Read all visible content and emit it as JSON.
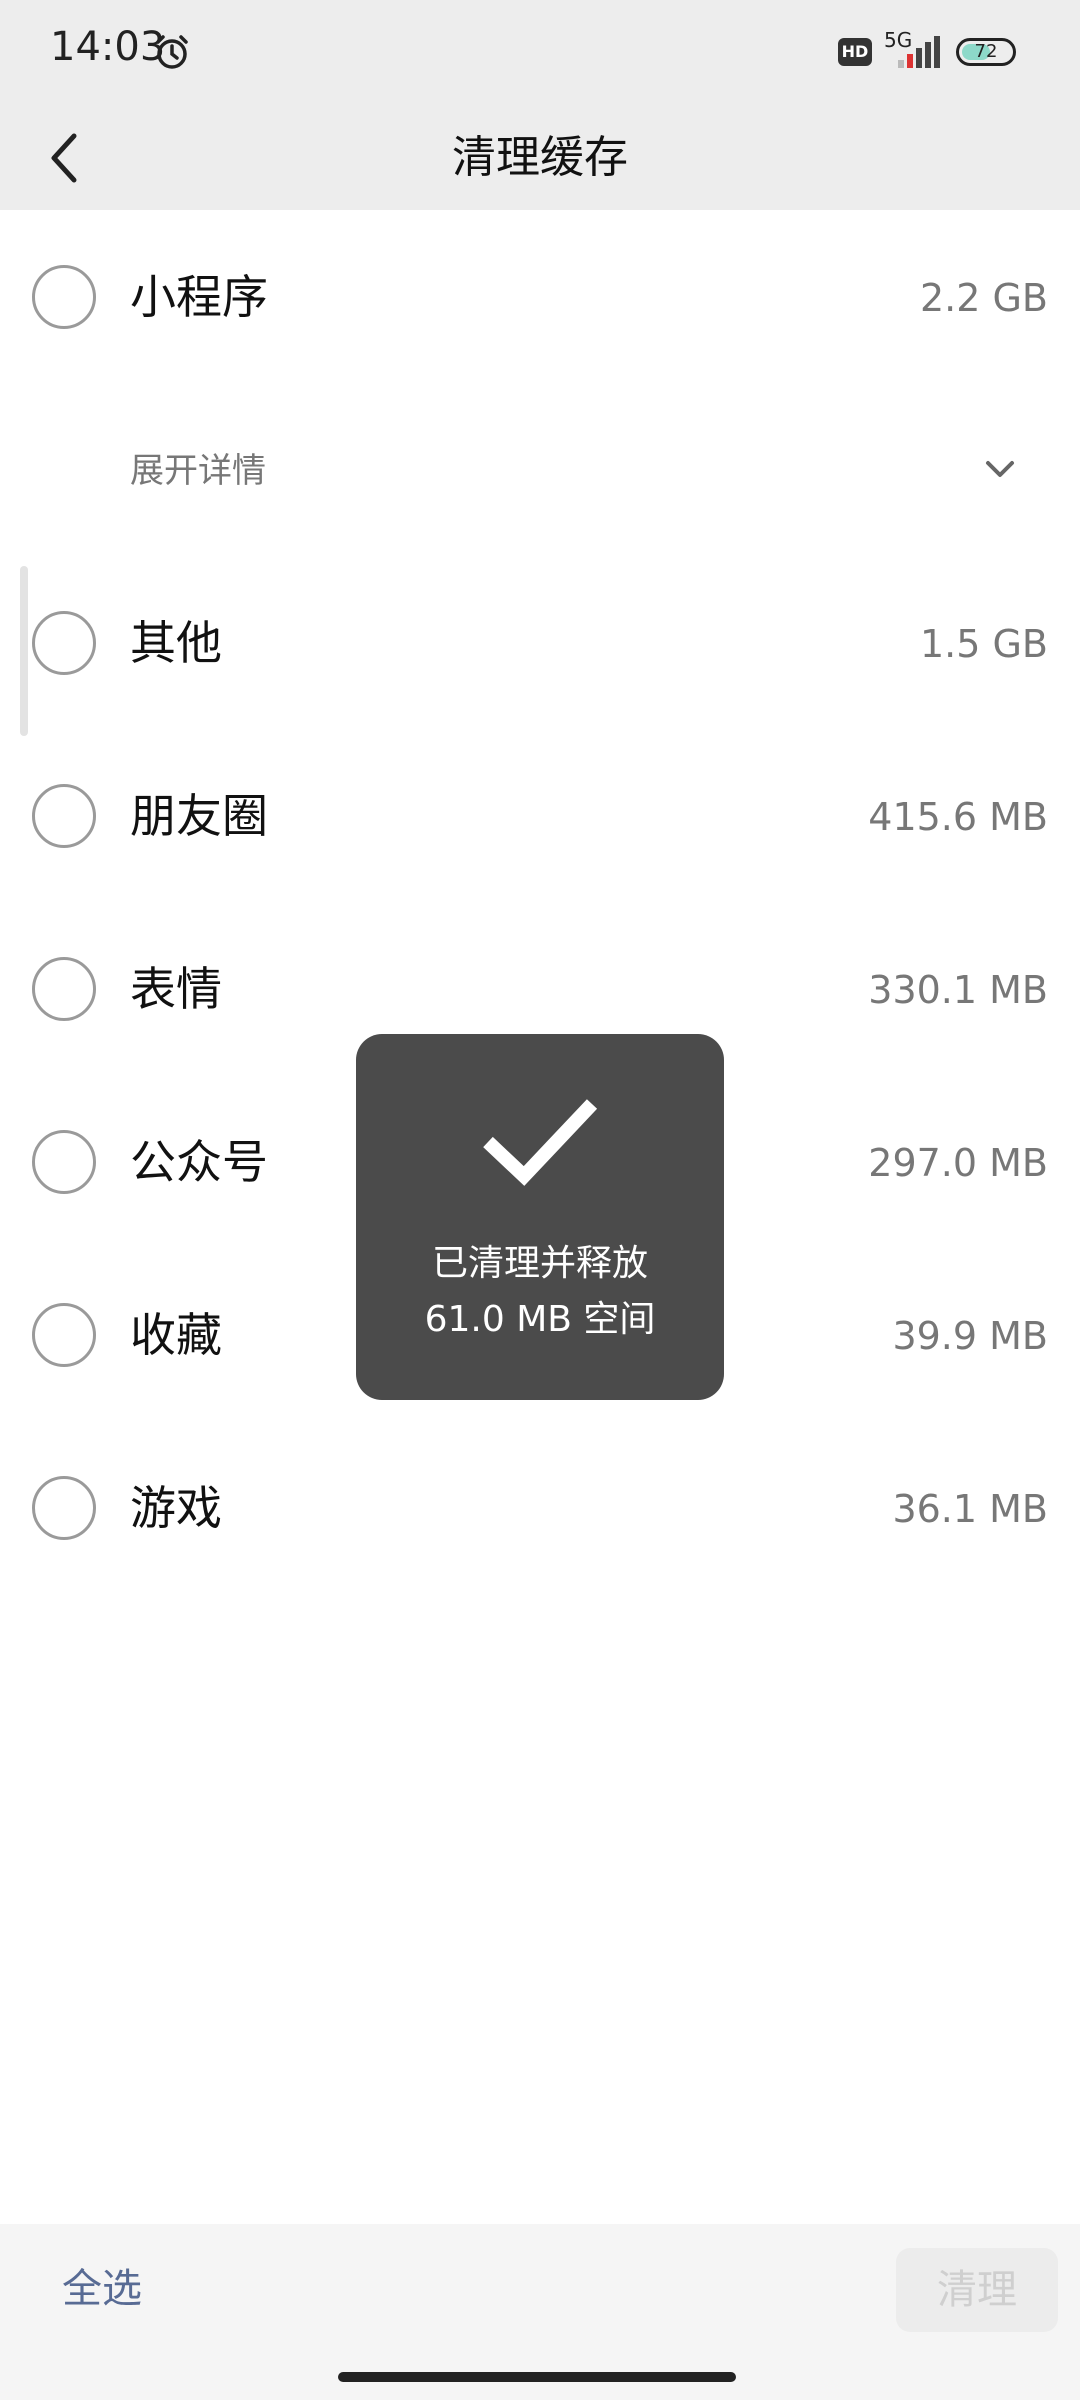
{
  "status_bar": {
    "time": "14:03",
    "network": "5G",
    "hd_badge": "HD",
    "battery": "72"
  },
  "header": {
    "title": "清理缓存"
  },
  "list": {
    "items": [
      {
        "label": "小程序",
        "size": "2.2 GB"
      },
      {
        "label": "其他",
        "size": "1.5 GB"
      },
      {
        "label": "朋友圈",
        "size": "415.6 MB"
      },
      {
        "label": "表情",
        "size": "330.1 MB"
      },
      {
        "label": "公众号",
        "size": "297.0 MB"
      },
      {
        "label": "收藏",
        "size": "39.9 MB"
      },
      {
        "label": "游戏",
        "size": "36.1 MB"
      }
    ],
    "expand_label": "展开详情"
  },
  "toast": {
    "line1": "已清理并释放",
    "line2": "61.0 MB 空间"
  },
  "bottom_bar": {
    "select_all": "全选",
    "clean_button": "清理"
  },
  "colors": {
    "background": "#ffffff",
    "header_bg": "#ededed",
    "accent_link": "#586b94",
    "toast_bg": "#4b4b4b"
  }
}
